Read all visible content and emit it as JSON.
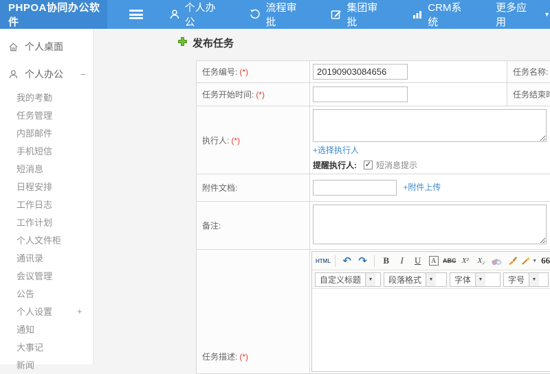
{
  "header": {
    "logo": "PHPOA协同办公软件",
    "nav": [
      {
        "label": "个人办公",
        "icon": "user-icon"
      },
      {
        "label": "流程审批",
        "icon": "history-icon"
      },
      {
        "label": "集团审批",
        "icon": "edit-icon"
      },
      {
        "label": "CRM系统",
        "icon": "bar-chart-icon"
      },
      {
        "label": "更多应用",
        "icon": "caret-down-icon"
      }
    ],
    "more_caret": "▼"
  },
  "sidebar": {
    "items": [
      {
        "label": "个人桌面",
        "level": "top",
        "icon": "home-icon"
      },
      {
        "label": "个人办公",
        "level": "top",
        "icon": "user-icon",
        "toggle": "−"
      },
      {
        "label": "我的考勤",
        "level": "sub"
      },
      {
        "label": "任务管理",
        "level": "sub"
      },
      {
        "label": "内部邮件",
        "level": "sub"
      },
      {
        "label": "手机短信",
        "level": "sub"
      },
      {
        "label": "短消息",
        "level": "sub"
      },
      {
        "label": "日程安排",
        "level": "sub"
      },
      {
        "label": "工作日志",
        "level": "sub"
      },
      {
        "label": "工作计划",
        "level": "sub"
      },
      {
        "label": "个人文件柜",
        "level": "sub"
      },
      {
        "label": "通讯录",
        "level": "sub"
      },
      {
        "label": "会议管理",
        "level": "sub"
      },
      {
        "label": "公告",
        "level": "sub"
      },
      {
        "label": "个人设置",
        "level": "sub",
        "toggle": "+"
      },
      {
        "label": "通知",
        "level": "sub"
      },
      {
        "label": "大事记",
        "level": "sub"
      },
      {
        "label": "新闻",
        "level": "sub"
      }
    ]
  },
  "main": {
    "title": "发布任务",
    "form": {
      "required_mark": "(*)",
      "task_no_label": "任务编号:",
      "task_no_value": "20190903084656",
      "task_name_label": "任务名称:",
      "start_time_label": "任务开始时间:",
      "end_time_label": "任务结束时间:",
      "executor_label": "执行人:",
      "choose_executor_link": "+选择执行人",
      "remind_label": "提醒执行人:",
      "sms_checkbox_label": "短消息提示",
      "sms_checkbox_checked": "✓",
      "attachment_label": "附件文档:",
      "attachment_upload_link": "+附件上传",
      "remark_label": "备注:",
      "desc_label": "任务描述:"
    },
    "editor": {
      "html_button": "HTML",
      "undo_glyph": "↶",
      "redo_glyph": "↷",
      "bold": "B",
      "italic": "I",
      "underline": "U",
      "font_box": "A",
      "strike": "ABC",
      "superscript": "X²",
      "subscript": "X₂",
      "quote": "66",
      "paste_glyph": "T",
      "font_color": "A",
      "dropdowns": [
        "自定义标题",
        "段落格式",
        "字体",
        "字号"
      ],
      "dd_caret": "▼"
    }
  },
  "colors": {
    "topbar": "#4797e1",
    "logo_bg": "#3d89d3",
    "link_blue": "#3b8bd0",
    "required_red": "#e03c31",
    "plus_green": "#6fbf38"
  }
}
